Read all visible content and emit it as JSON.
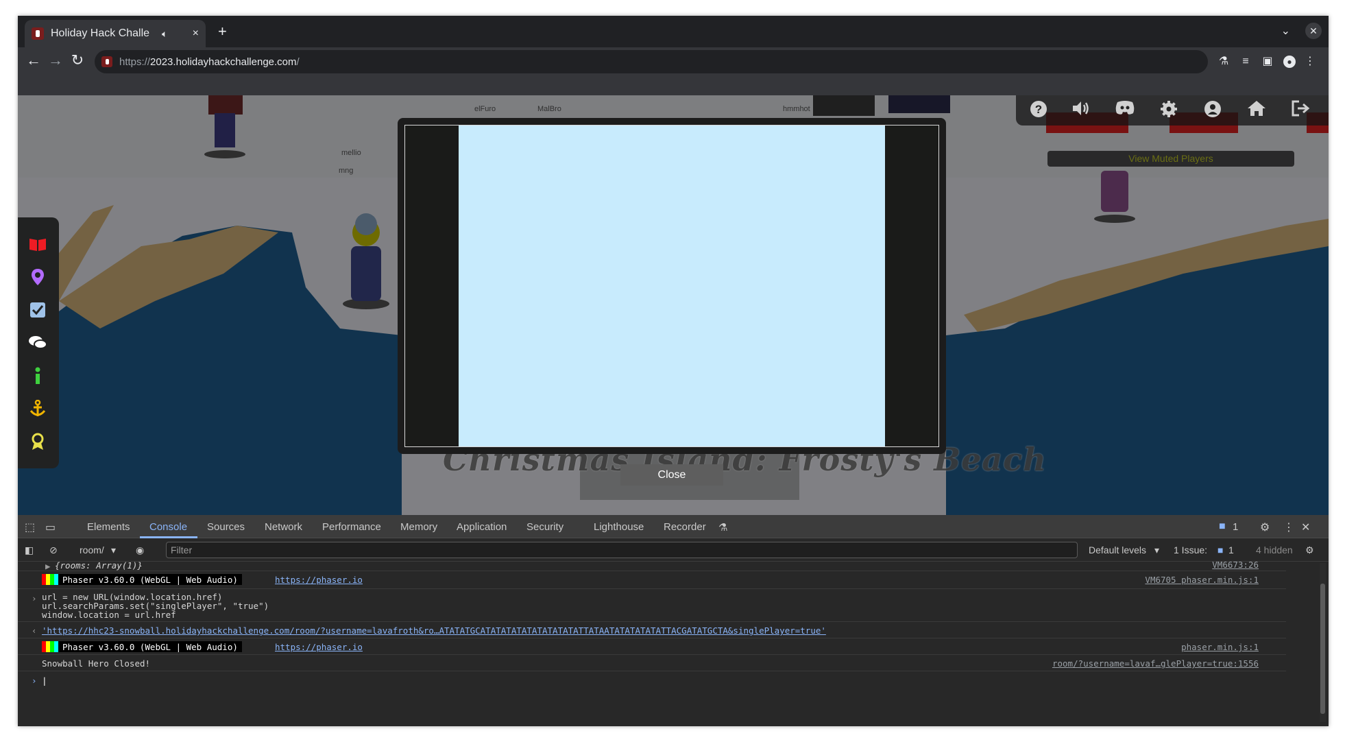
{
  "browser": {
    "tab_title": "Holiday Hack Challe",
    "tab_audio_icon": "speaker-icon",
    "tab_close": "×",
    "new_tab": "+",
    "url_scheme": "https://",
    "url_host": "2023.holidayhackchallenge.com",
    "url_path": "/"
  },
  "game": {
    "muted_players": "View Muted Players",
    "close_label": "Close",
    "location_title": "Christmas Island: Frosty's Beach",
    "player_names": [
      "elFuro",
      "MalBro",
      "hmmhot",
      "mellio",
      "mng"
    ],
    "sidebar_icons": [
      "book-icon",
      "map-pin-icon",
      "checkbox-icon",
      "chat-icon",
      "info-icon",
      "anchor-icon",
      "badge-icon"
    ],
    "top_icons": [
      "help-icon",
      "sound-icon",
      "discord-icon",
      "settings-icon",
      "profile-icon",
      "home-icon",
      "logout-icon"
    ],
    "colors": {
      "accent_red": "#ee1c24",
      "modal_frame": "#c8ebfd"
    }
  },
  "devtools": {
    "tabs": [
      "Elements",
      "Console",
      "Sources",
      "Network",
      "Performance",
      "Memory",
      "Application",
      "Security",
      "Lighthouse",
      "Recorder"
    ],
    "active_tab": "Console",
    "issues_badge": "1",
    "context": "room/",
    "filter_placeholder": "Filter",
    "default_levels": "Default levels",
    "issues_text": "1 Issue:",
    "issues_count": "1",
    "hidden": "4 hidden",
    "console": {
      "obj_preview": "{rooms: Array(1)}",
      "obj_source": "VM6673:26",
      "phaser_label": "Phaser v3.60.0 (WebGL | Web Audio)",
      "phaser_link": "https://phaser.io",
      "phaser_src_1": "VM6705 phaser.min.js:1",
      "input_lines": [
        "url = new URL(window.location.href)",
        "url.searchParams.set(\"singlePlayer\", \"true\")",
        "window.location = url.href"
      ],
      "result_url": "'https://hhc23-snowball.holidayhackchallenge.com/room/?username=lavafroth&ro…ATATATGCATATATATATATATATATATTATAATATATATATATTACGATATGCTA&singlePlayer=true'",
      "phaser_src_2": "phaser.min.js:1",
      "log_text": "Snowball Hero Closed!",
      "log_src": "room/?username=lavaf…glePlayer=true:1556"
    }
  }
}
